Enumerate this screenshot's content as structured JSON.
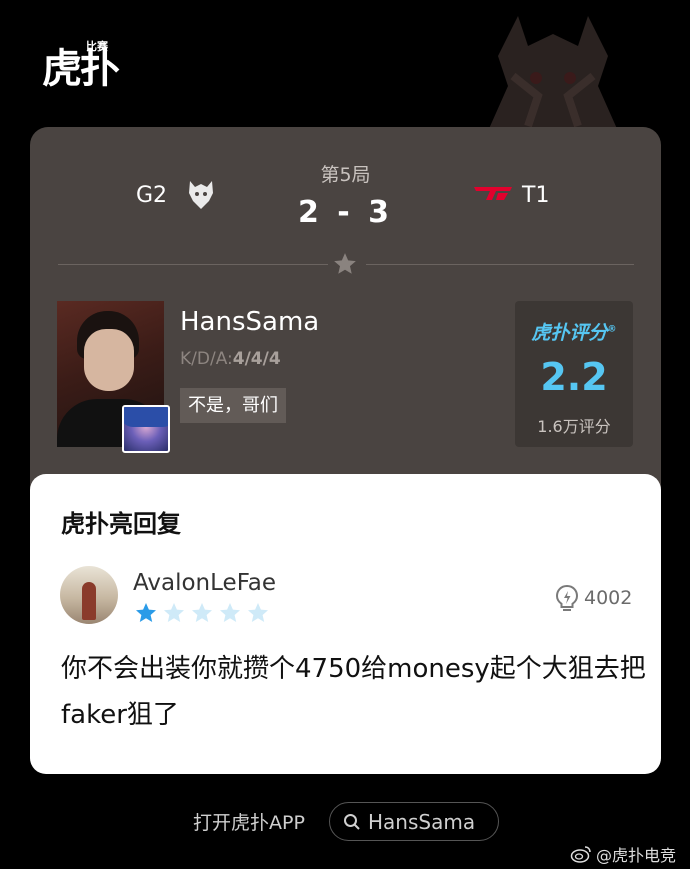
{
  "brand": {
    "logo_text": "虎扑",
    "logo_small": "比赛"
  },
  "match": {
    "round_label": "第5局",
    "score": "2 - 3",
    "team_left": "G2",
    "team_right": "T1"
  },
  "player": {
    "name": "HansSama",
    "kda_label": "K/D/A:",
    "kda_value": "4/4/4",
    "tag": "不是，哥们"
  },
  "rating": {
    "brand": "虎扑评分",
    "value": "2.2",
    "count": "1.6万评分"
  },
  "reply": {
    "title": "虎扑亮回复",
    "username": "AvalonLeFae",
    "stars_filled": 1,
    "stars_total": 5,
    "likes": "4002",
    "text": "你不会出装你就攒个4750给monesy起个大狙去把faker狙了"
  },
  "footer": {
    "open_app": "打开虎扑APP",
    "search_text": "HansSama"
  },
  "watermark": {
    "text": "@虎扑电竞"
  },
  "colors": {
    "accent": "#56c6f2",
    "star_filled": "#2a9be8",
    "star_empty": "#cfeaf8",
    "card_bg": "#4a4441"
  },
  "icons": [
    "g2-logo-icon",
    "t1-logo-icon",
    "star-icon",
    "lightbulb-icon",
    "search-icon",
    "weibo-icon"
  ]
}
